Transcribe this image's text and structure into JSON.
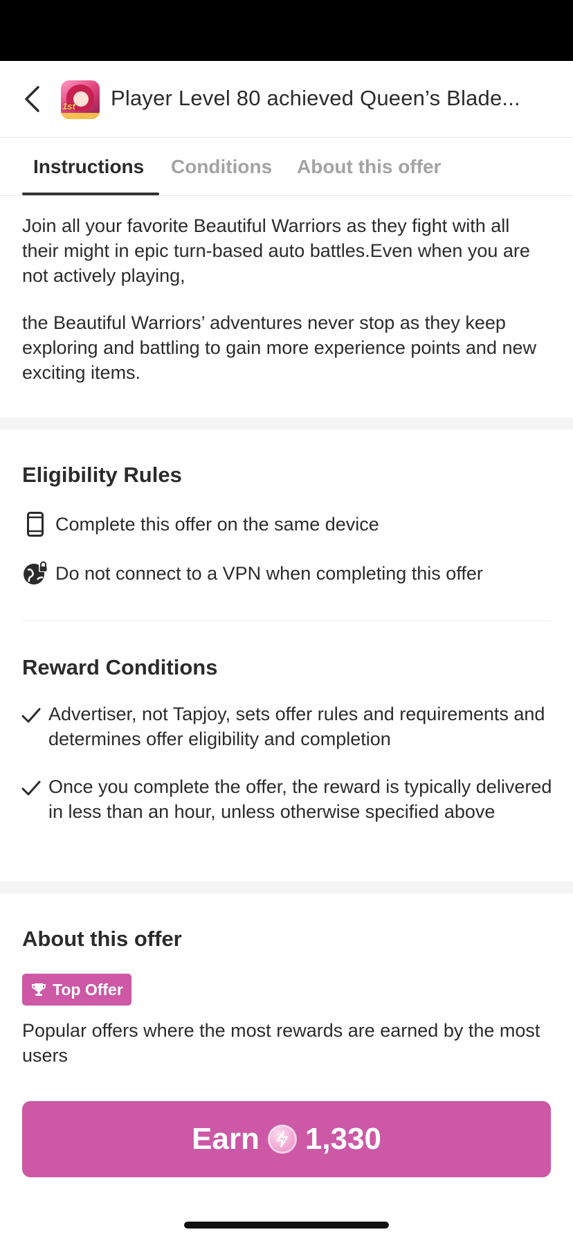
{
  "header": {
    "title": "Player Level 80 achieved Queen’s Blade...",
    "app_icon_text": "1st"
  },
  "tabs": [
    {
      "label": "Instructions",
      "active": true
    },
    {
      "label": "Conditions",
      "active": false
    },
    {
      "label": "About this offer",
      "active": false
    }
  ],
  "instructions": {
    "paragraph_1": "Join all your favorite Beautiful Warriors as they fight with all their might in epic turn-based auto battles.Even when you are not actively playing,",
    "paragraph_2": "the Beautiful Warriors’ adventures never stop as they keep exploring and battling to gain more experience points and new exciting items."
  },
  "eligibility": {
    "title": "Eligibility Rules",
    "rules": [
      {
        "icon": "phone-icon",
        "text": "Complete this offer on the same device"
      },
      {
        "icon": "globe-lock-icon",
        "text": "Do not connect to a VPN when completing this offer"
      }
    ]
  },
  "reward_conditions": {
    "title": "Reward Conditions",
    "items": [
      "Advertiser, not Tapjoy, sets offer rules and requirements and determines offer eligibility and completion",
      "Once you complete the offer, the reward is typically delivered in less than an hour, unless otherwise specified above"
    ]
  },
  "about": {
    "title": "About this offer",
    "badge_label": "Top Offer",
    "description": "Popular offers where the most rewards are earned by the most users"
  },
  "earn_button": {
    "label": "Earn",
    "amount": "1,330"
  },
  "colors": {
    "accent": "#cc58a6",
    "text": "#2b2b2b",
    "muted_tab": "#a3a3a3",
    "section_gap": "#f4f4f4"
  }
}
